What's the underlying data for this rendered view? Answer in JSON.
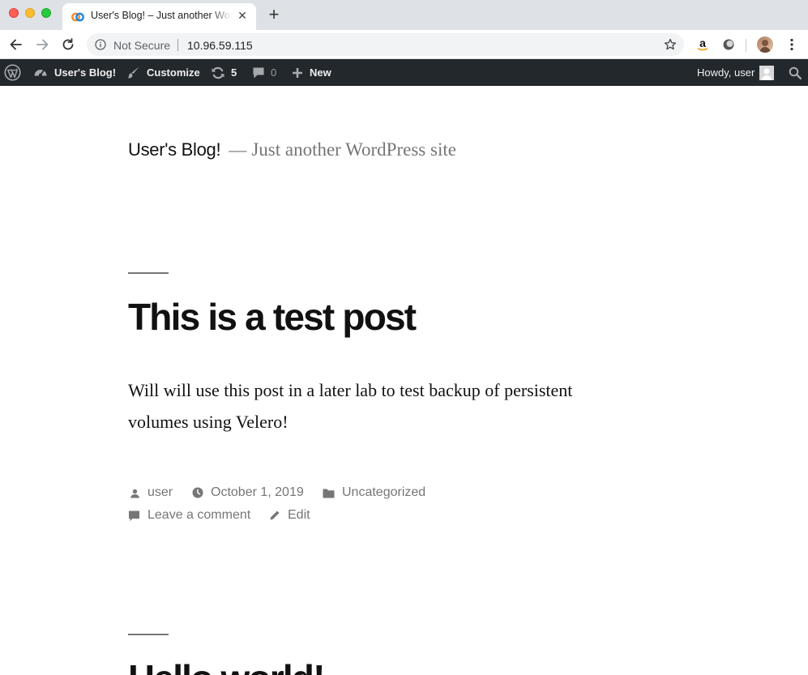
{
  "browser": {
    "tab_title": "User's Blog! – Just another WordPress site",
    "security_label": "Not Secure",
    "url": "10.96.59.115"
  },
  "adminbar": {
    "site_name": "User's Blog!",
    "customize": "Customize",
    "updates_count": "5",
    "comments_count": "0",
    "new_label": "New",
    "howdy": "Howdy, user"
  },
  "site": {
    "title": "User's Blog!",
    "separator": "—",
    "description": "Just another WordPress site"
  },
  "posts": [
    {
      "title": "This is a test post",
      "content": "Will will use this post in a later lab to test backup of persistent volumes using Velero!",
      "author": "user",
      "date": "October 1, 2019",
      "category": "Uncategorized",
      "comment_link": "Leave a comment",
      "edit_link": "Edit"
    },
    {
      "title": "Hello world!"
    }
  ],
  "colors": {
    "adminbar_bg": "#23282d",
    "meta_text": "#767676",
    "text": "#111111"
  }
}
